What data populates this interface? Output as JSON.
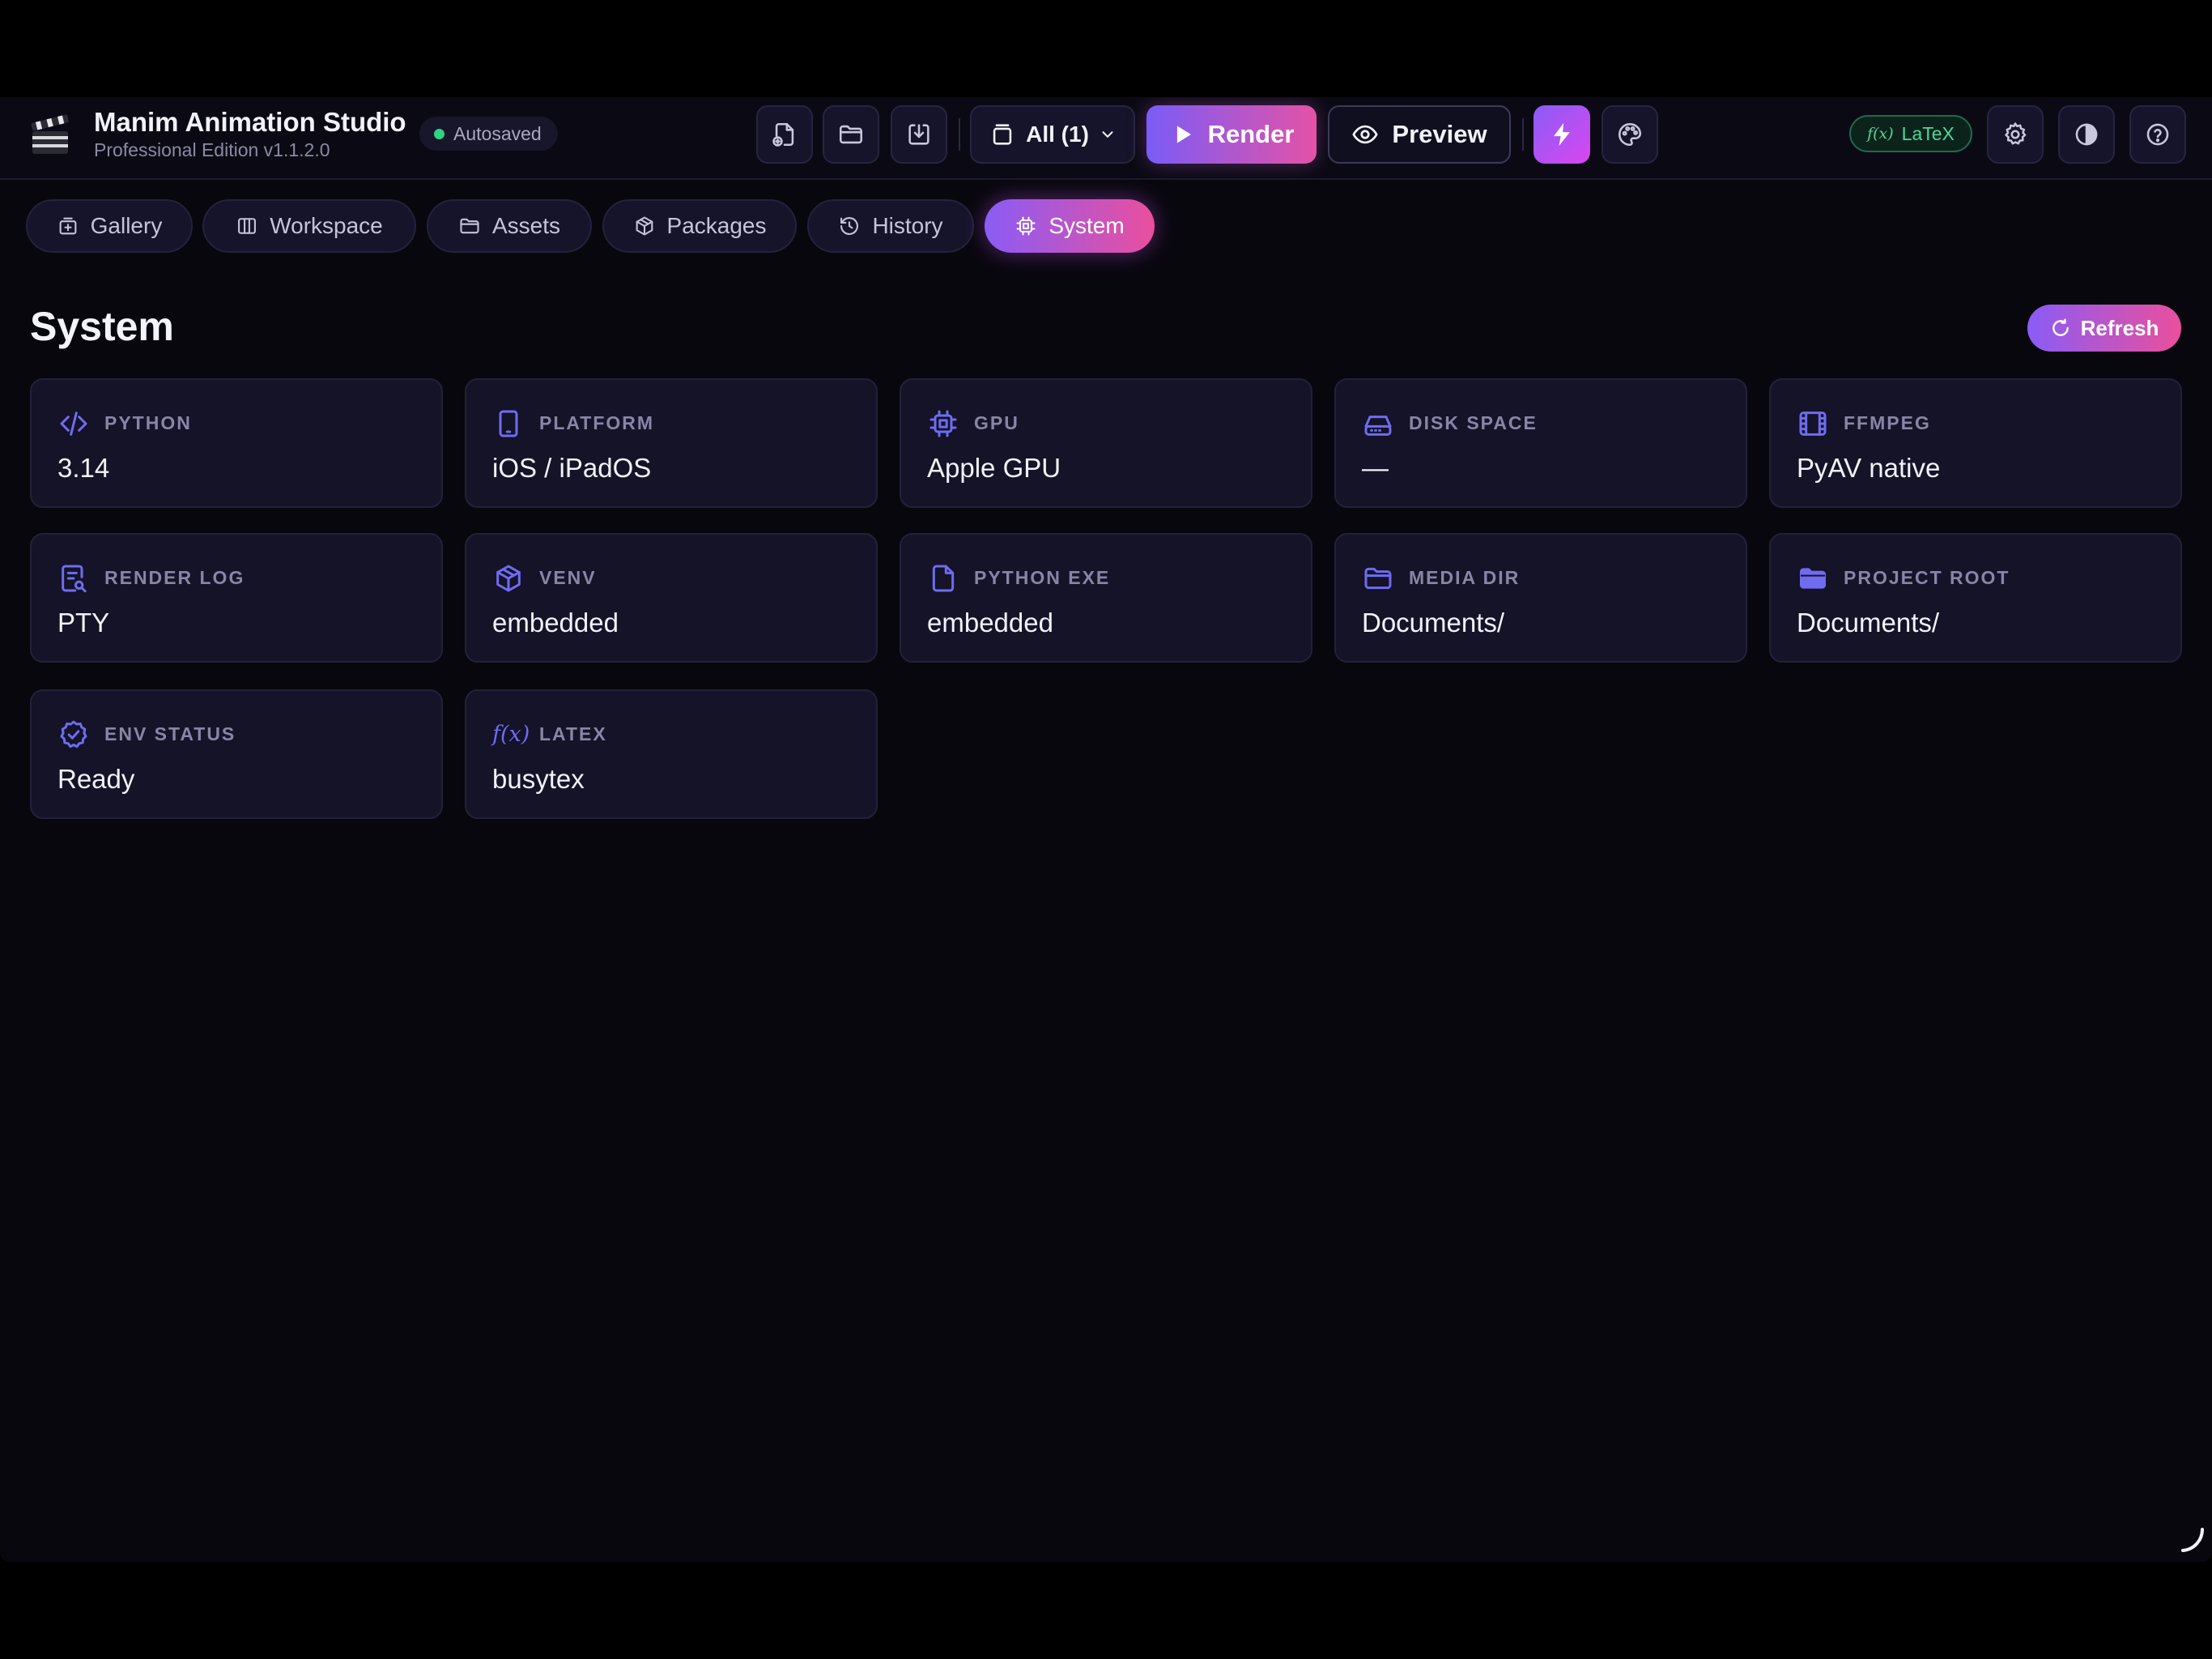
{
  "header": {
    "title": "Manim Animation Studio",
    "subtitle": "Professional Edition v1.1.2.0",
    "autosave": "Autosaved",
    "scene_selector": "All (1)",
    "render_label": "Render",
    "preview_label": "Preview",
    "latex_badge": "LaTeX",
    "latex_fx": "f(x)"
  },
  "tabs": [
    {
      "label": "Gallery",
      "icon": "gallery-icon"
    },
    {
      "label": "Workspace",
      "icon": "columns-icon"
    },
    {
      "label": "Assets",
      "icon": "folder-icon"
    },
    {
      "label": "Packages",
      "icon": "package-icon"
    },
    {
      "label": "History",
      "icon": "history-icon"
    },
    {
      "label": "System",
      "icon": "cpu-icon",
      "active": true
    }
  ],
  "page": {
    "title": "System",
    "refresh_label": "Refresh"
  },
  "cards": [
    {
      "label": "PYTHON",
      "value": "3.14",
      "icon": "code-icon"
    },
    {
      "label": "PLATFORM",
      "value": "iOS / iPadOS",
      "icon": "tablet-icon"
    },
    {
      "label": "GPU",
      "value": "Apple GPU",
      "icon": "chip-icon"
    },
    {
      "label": "DISK SPACE",
      "value": "—",
      "icon": "hard-drive-icon"
    },
    {
      "label": "FFMPEG",
      "value": "PyAV native",
      "icon": "film-icon"
    },
    {
      "label": "RENDER LOG",
      "value": "PTY",
      "icon": "log-search-icon"
    },
    {
      "label": "VENV",
      "value": "embedded",
      "icon": "package-icon"
    },
    {
      "label": "PYTHON EXE",
      "value": "embedded",
      "icon": "file-icon"
    },
    {
      "label": "MEDIA DIR",
      "value": "Documents/",
      "icon": "folder-icon"
    },
    {
      "label": "PROJECT ROOT",
      "value": "Documents/",
      "icon": "folder-filled-icon"
    },
    {
      "label": "ENV STATUS",
      "value": "Ready",
      "icon": "badge-check-icon"
    },
    {
      "label": "LATEX",
      "value": "busytex",
      "icon": "function-icon",
      "icon_text": "f(x)"
    }
  ],
  "colors": {
    "accent_start": "#8a5cf6",
    "accent_end": "#ea4f9d",
    "icon": "#6f6cf0",
    "autosave_dot": "#2fd27e",
    "latex_green": "#4fd79b"
  }
}
